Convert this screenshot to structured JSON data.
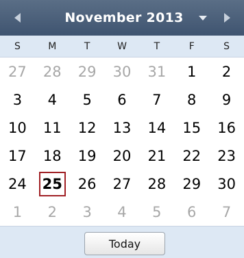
{
  "header": {
    "title": "November 2013",
    "prev_icon": "triangle-left-icon",
    "next_icon": "triangle-right-icon",
    "dropdown_icon": "triangle-down-icon"
  },
  "weekdays": [
    "S",
    "M",
    "T",
    "W",
    "T",
    "F",
    "S"
  ],
  "weeks": [
    [
      {
        "d": "27",
        "other": true
      },
      {
        "d": "28",
        "other": true
      },
      {
        "d": "29",
        "other": true
      },
      {
        "d": "30",
        "other": true
      },
      {
        "d": "31",
        "other": true
      },
      {
        "d": "1"
      },
      {
        "d": "2"
      }
    ],
    [
      {
        "d": "3"
      },
      {
        "d": "4"
      },
      {
        "d": "5"
      },
      {
        "d": "6"
      },
      {
        "d": "7"
      },
      {
        "d": "8"
      },
      {
        "d": "9"
      }
    ],
    [
      {
        "d": "10"
      },
      {
        "d": "11"
      },
      {
        "d": "12"
      },
      {
        "d": "13"
      },
      {
        "d": "14"
      },
      {
        "d": "15"
      },
      {
        "d": "16"
      }
    ],
    [
      {
        "d": "17"
      },
      {
        "d": "18"
      },
      {
        "d": "19"
      },
      {
        "d": "20"
      },
      {
        "d": "21"
      },
      {
        "d": "22"
      },
      {
        "d": "23"
      }
    ],
    [
      {
        "d": "24"
      },
      {
        "d": "25",
        "today": true
      },
      {
        "d": "26"
      },
      {
        "d": "27"
      },
      {
        "d": "28"
      },
      {
        "d": "29"
      },
      {
        "d": "30"
      }
    ],
    [
      {
        "d": "1",
        "other": true
      },
      {
        "d": "2",
        "other": true
      },
      {
        "d": "3",
        "other": true
      },
      {
        "d": "4",
        "other": true
      },
      {
        "d": "5",
        "other": true
      },
      {
        "d": "6",
        "other": true
      },
      {
        "d": "7",
        "other": true
      }
    ]
  ],
  "footer": {
    "today_label": "Today"
  },
  "colors": {
    "header_bg": "#4a5f7a",
    "weekday_bg": "#dde8f4",
    "other_month_text": "#a7a7a7",
    "today_border": "#a01f24"
  }
}
